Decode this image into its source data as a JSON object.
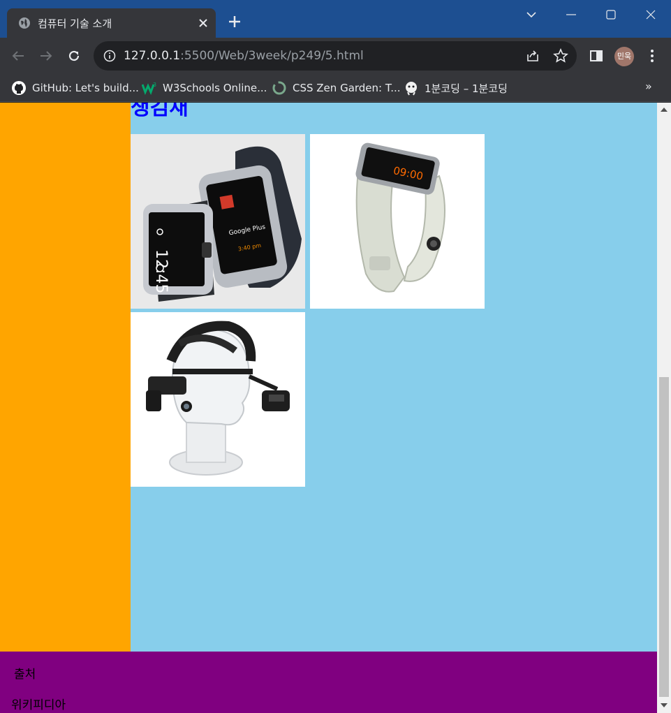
{
  "browser": {
    "tab": {
      "title": "컴퓨터 기술 소개",
      "favicon": "globe-icon"
    },
    "address_bar": {
      "host": "127.0.0.1",
      "path": ":5500/Web/3week/p249/5.html"
    },
    "profile_initials": "민욱",
    "bookmarks": [
      {
        "label": "GitHub: Let's build...",
        "icon": "github-icon"
      },
      {
        "label": "W3Schools Online...",
        "icon": "w3schools-icon"
      },
      {
        "label": "CSS Zen Garden: T...",
        "icon": "zen-garden-icon"
      },
      {
        "label": "1분코딩 – 1분코딩",
        "icon": "1bun-coding-icon"
      }
    ],
    "bookmarks_overflow": "»"
  },
  "page": {
    "section_heading": "생김새",
    "images": [
      {
        "name": "gear-2-smartwatch-image"
      },
      {
        "name": "galaxy-gear-watch-image"
      },
      {
        "name": "head-mounted-display-image"
      }
    ],
    "footer": {
      "source_label": "출처",
      "source_value": "위키피디아"
    }
  },
  "colors": {
    "sidebar": "#ffa500",
    "main": "#87ceeb",
    "footer": "#800080",
    "heading": "#0000ff"
  }
}
